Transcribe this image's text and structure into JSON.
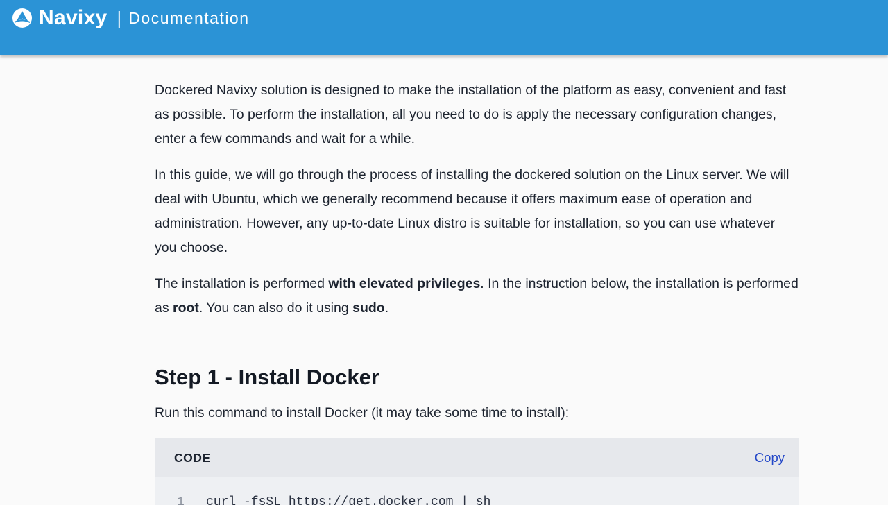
{
  "header": {
    "brand_name": "Navixy",
    "separator": "|",
    "section": "Documentation",
    "logo_icon": "navixy-logo-icon",
    "background_color": "#2b93d6"
  },
  "intro": {
    "p1": "Dockered Navixy solution is designed to make the installation of the platform as easy, convenient and fast as possible. To perform the installation, all you need to do is apply the necessary configuration changes, enter a few commands and wait for a while.",
    "p2": "In this guide, we will go through the process of installing the dockered solution on the Linux server. We will deal with Ubuntu, which we generally recommend because it offers maximum ease of operation and administration. However, any up-to-date Linux distro is suitable for installation, so you can use whatever you choose.",
    "p3": {
      "t1": "The installation is performed ",
      "b1": "with elevated privileges",
      "t2": ". In the instruction below, the installation is performed as ",
      "b2": "root",
      "t3": ". You can also do it using ",
      "b3": "sudo",
      "t4": "."
    }
  },
  "step1": {
    "heading": "Step 1 - Install Docker",
    "description": "Run this command to install Docker (it may take some time to install):",
    "code": {
      "label": "CODE",
      "copy_label": "Copy",
      "copy_color": "#2448c8",
      "line_number": "1",
      "line_text": "curl -fsSL https://get.docker.com | sh"
    }
  }
}
